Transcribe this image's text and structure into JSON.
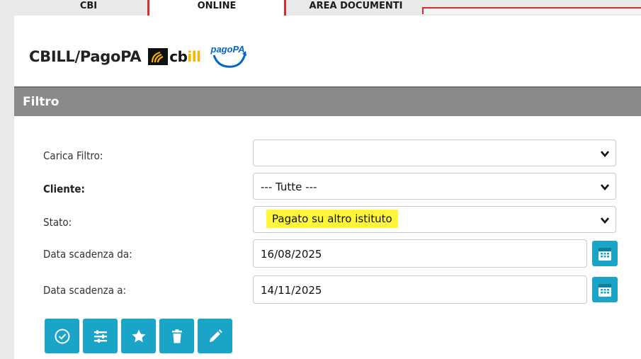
{
  "topnav": {
    "tabs": [
      "CBI",
      "ONLINE",
      "AREA DOCUMENTI"
    ]
  },
  "header": {
    "title": "CBILL/PagoPA",
    "cbill_logo_text": "cbill",
    "pagopa_logo_text": "pagoPA"
  },
  "filter": {
    "title": "Filtro",
    "fields": {
      "carica_filtro": {
        "label": "Carica Filtro:",
        "value": ""
      },
      "cliente": {
        "label": "Cliente:",
        "value": "--- Tutte ---"
      },
      "stato": {
        "label": "Stato:",
        "value": "Pagato su altro istituto"
      },
      "data_da": {
        "label": "Data scadenza da:",
        "value": "16/08/2025"
      },
      "data_a": {
        "label": "Data scadenza a:",
        "value": "14/11/2025"
      }
    }
  },
  "icons": {
    "dropdown": "chevron-down-icon",
    "calendar": "calendar-icon",
    "actions": [
      "check-circle-icon",
      "sliders-icon",
      "star-icon",
      "trash-icon",
      "pencil-icon"
    ]
  },
  "colors": {
    "accent": "#1aa5c8",
    "header_bar": "#8a8a8a",
    "tab_border": "#d32f2f",
    "highlight": "#fff53a",
    "cbill_yellow": "#f7b500",
    "pagopa_blue": "#0066cc"
  }
}
